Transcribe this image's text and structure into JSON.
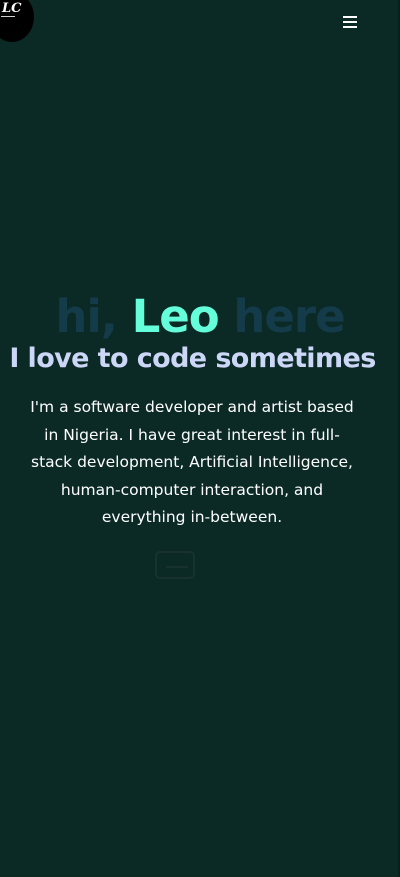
{
  "logo": {
    "text": "LC"
  },
  "header": {
    "menu_icon": "hamburger-menu-icon"
  },
  "hero": {
    "greeting_prefix": "hi,",
    "name": "Leo",
    "greeting_suffix": "here",
    "tagline": "I love to code sometimes",
    "bio": "I'm a software developer and artist based in Nigeria. I have great interest in full-stack development, Artificial Intelligence, human-computer interaction, and everything in-between."
  },
  "colors": {
    "background": "#0b2a26",
    "accent": "#64ffda",
    "dim_text": "#143b49",
    "subheading": "#ccd6f6"
  }
}
